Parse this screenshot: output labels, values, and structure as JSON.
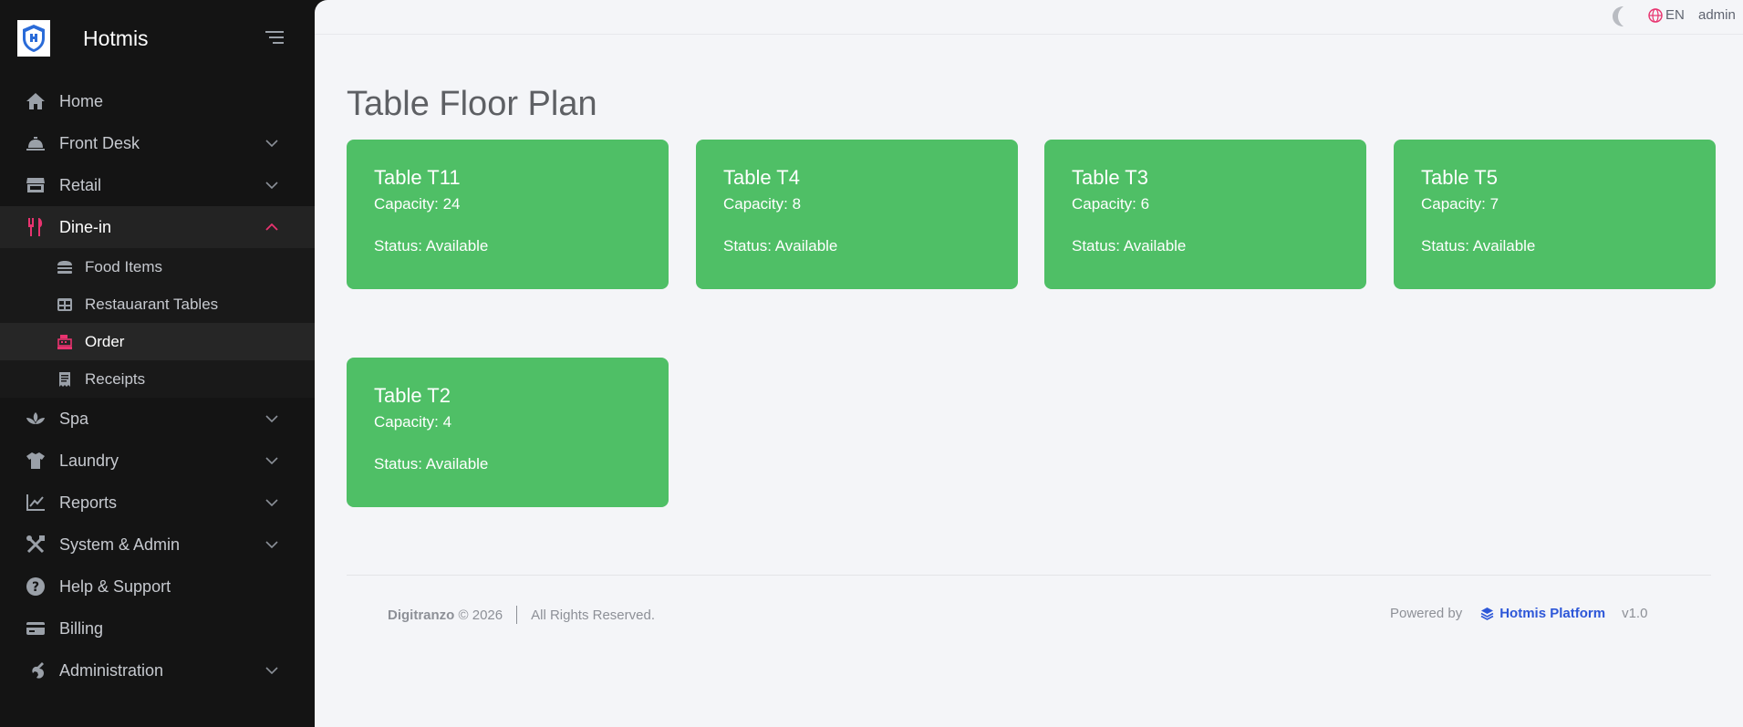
{
  "app": {
    "name": "Hotmis"
  },
  "sidebar": {
    "items": [
      {
        "label": "Home",
        "icon": "home-icon"
      },
      {
        "label": "Front Desk",
        "icon": "bell-icon",
        "expandable": true
      },
      {
        "label": "Retail",
        "icon": "store-icon",
        "expandable": true
      },
      {
        "label": "Dine-in",
        "icon": "utensils-icon",
        "expandable": true,
        "expanded": true,
        "children": [
          {
            "label": "Food Items",
            "icon": "burger-icon"
          },
          {
            "label": "Restauarant Tables",
            "icon": "table-icon"
          },
          {
            "label": "Order",
            "icon": "cash-register-icon",
            "active": true
          },
          {
            "label": "Receipts",
            "icon": "receipt-icon"
          }
        ]
      },
      {
        "label": "Spa",
        "icon": "spa-icon",
        "expandable": true
      },
      {
        "label": "Laundry",
        "icon": "shirt-icon",
        "expandable": true
      },
      {
        "label": "Reports",
        "icon": "chart-line-icon",
        "expandable": true
      },
      {
        "label": "System & Admin",
        "icon": "tools-icon",
        "expandable": true
      },
      {
        "label": "Help & Support",
        "icon": "question-icon"
      },
      {
        "label": "Billing",
        "icon": "credit-card-icon"
      },
      {
        "label": "Administration",
        "icon": "wrench-icon",
        "expandable": true
      }
    ]
  },
  "topbar": {
    "language": "EN",
    "user": "admin"
  },
  "page": {
    "title": "Table Floor Plan"
  },
  "tables": [
    {
      "name": "Table T11",
      "capacity": "Capacity: 24",
      "status": "Status: Available"
    },
    {
      "name": "Table T4",
      "capacity": "Capacity: 8",
      "status": "Status: Available"
    },
    {
      "name": "Table T3",
      "capacity": "Capacity: 6",
      "status": "Status: Available"
    },
    {
      "name": "Table T5",
      "capacity": "Capacity: 7",
      "status": "Status: Available"
    },
    {
      "name": "Table T2",
      "capacity": "Capacity: 4",
      "status": "Status: Available"
    }
  ],
  "footer": {
    "company": "Digitranzo",
    "copyright": "© 2026",
    "rights": "All Rights Reserved.",
    "powered_by": "Powered by",
    "platform": "Hotmis Platform",
    "version": "v1.0"
  },
  "colors": {
    "sidebar_bg": "#141414",
    "accent": "#e8336f",
    "card_available": "#4fbf66",
    "main_bg": "#f4f5f8",
    "platform_link": "#2d57d8"
  }
}
